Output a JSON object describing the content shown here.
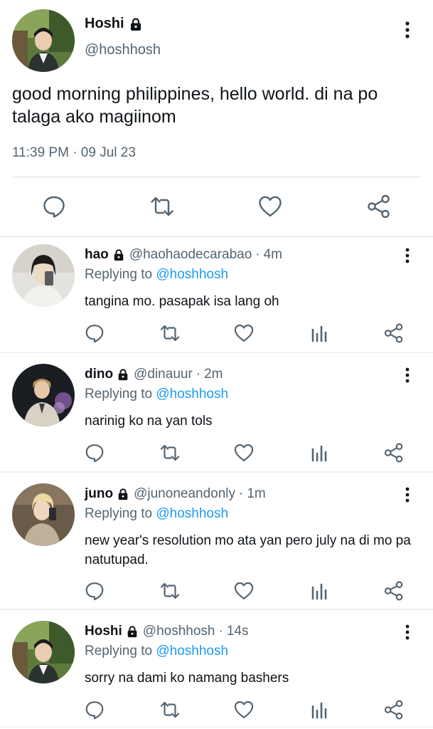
{
  "main_tweet": {
    "name": "Hoshi",
    "handle": "@hoshhosh",
    "text": "good morning philippines, hello world. di na po talaga ako magiinom",
    "timestamp": "11:39 PM · 09 Jul 23",
    "icons": {
      "reply": "comment-icon",
      "retweet": "retweet-icon",
      "like": "heart-icon",
      "share": "share-icon",
      "more": "more-vertical-icon",
      "lock": "lock-icon"
    }
  },
  "replies": [
    {
      "name": "hao",
      "handle": "@haohaodecarabao",
      "time": "4m",
      "replying_prefix": "Replying to",
      "replying_to": "@hoshhosh",
      "text": "tangina mo. pasapak isa lang oh"
    },
    {
      "name": "dino",
      "handle": "@dinauur",
      "time": "2m",
      "replying_prefix": "Replying to",
      "replying_to": "@hoshhosh",
      "text": "narinig ko na yan tols"
    },
    {
      "name": "juno",
      "handle": "@junoneandonly",
      "time": "1m",
      "replying_prefix": "Replying to",
      "replying_to": "@hoshhosh",
      "text": "new year's resolution mo ata yan pero july na di mo pa natutupad."
    },
    {
      "name": "Hoshi",
      "handle": "@hoshhosh",
      "time": "14s",
      "replying_prefix": "Replying to",
      "replying_to": "@hoshhosh",
      "text": "sorry na dami ko namang bashers"
    }
  ],
  "colors": {
    "text": "#0f1419",
    "secondary": "#536471",
    "link": "#1d9bf0",
    "divider": "#eef1f3"
  }
}
